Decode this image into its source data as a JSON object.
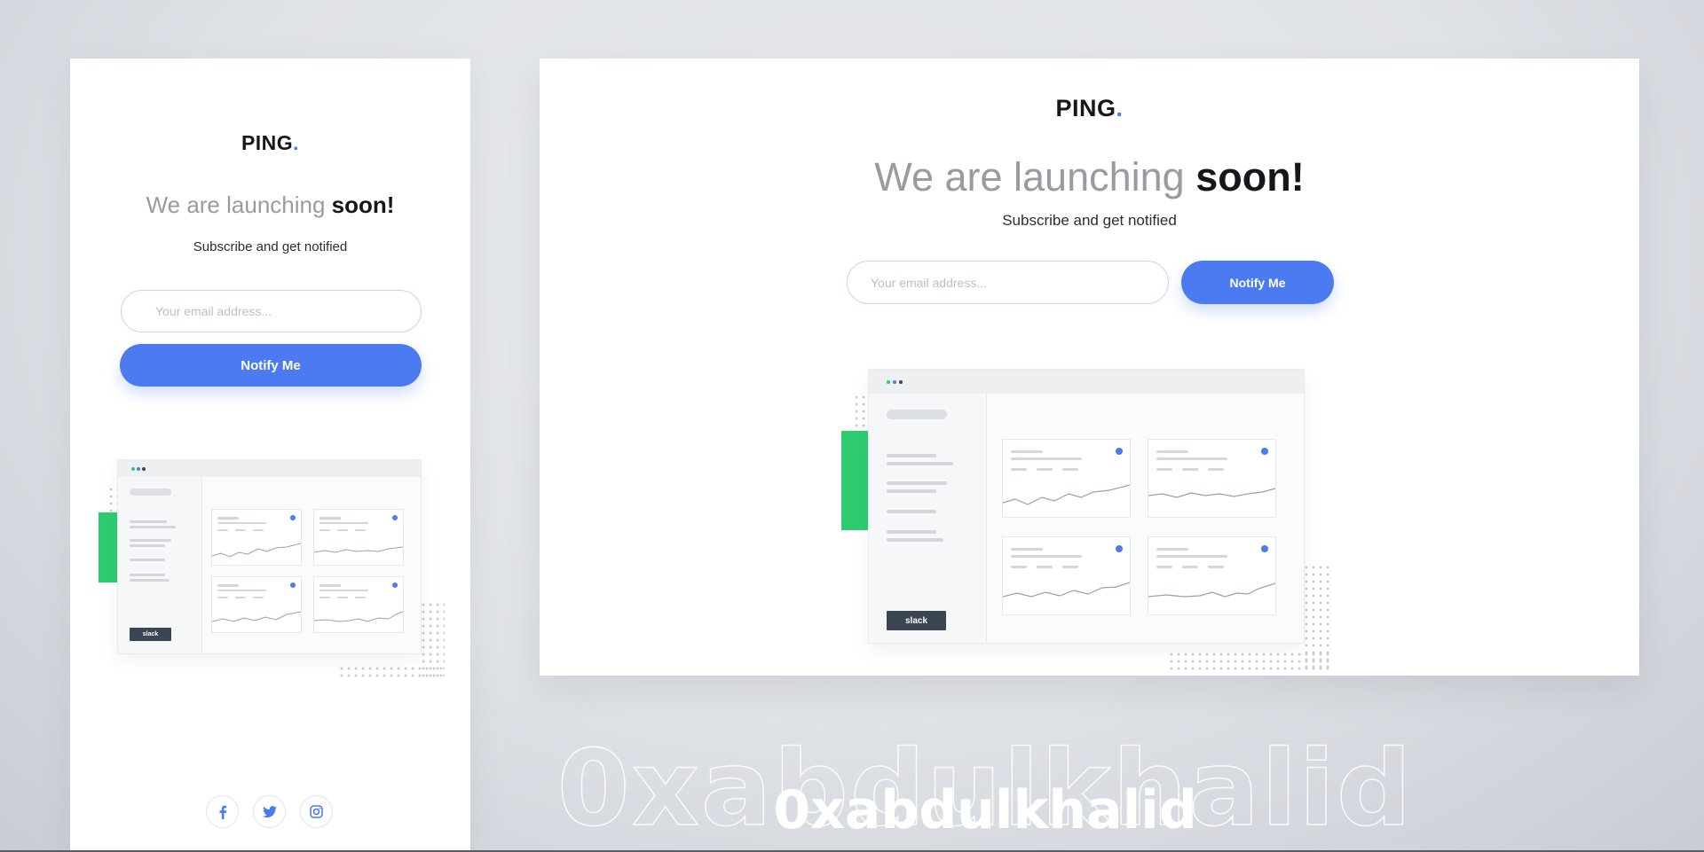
{
  "brand": {
    "name": "PING",
    "dot": "."
  },
  "hero": {
    "headline_light": "We are launching",
    "headline_bold": "soon!",
    "subtitle": "Subscribe and get notified"
  },
  "form": {
    "email_placeholder": "Your email address...",
    "button_label": "Notify Me"
  },
  "illustration": {
    "slack_label": "slack"
  },
  "social": [
    {
      "icon": "facebook-icon",
      "glyph": "f"
    },
    {
      "icon": "twitter-icon",
      "glyph": "t"
    },
    {
      "icon": "instagram-icon",
      "glyph": "i"
    }
  ],
  "watermark": "0xabdulkhalid",
  "colors": {
    "accent": "#4c7bf1",
    "green": "#2ecc71",
    "dark": "#15171c",
    "gray": "#9a9aa0"
  }
}
